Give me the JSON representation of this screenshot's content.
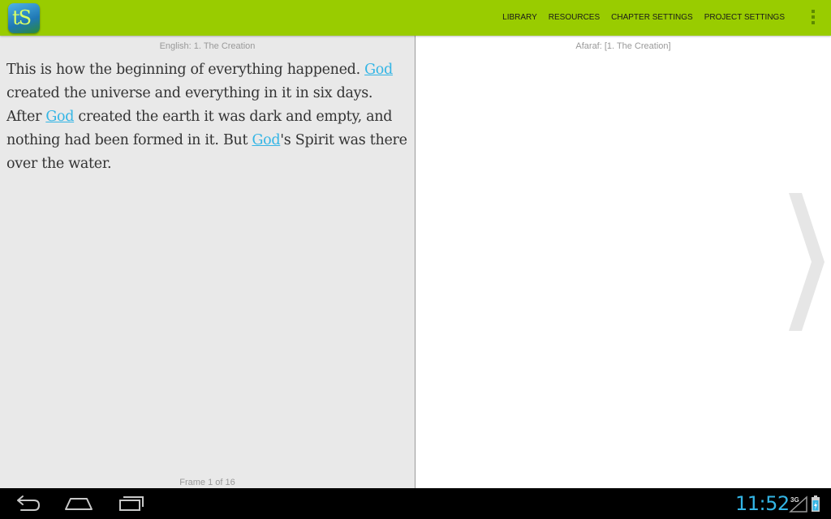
{
  "app": {
    "logo_text": "tS"
  },
  "actionbar": {
    "menu": [
      {
        "label": "LIBRARY"
      },
      {
        "label": "RESOURCES"
      },
      {
        "label": "CHAPTER SETTINGS"
      },
      {
        "label": "PROJECT SETTINGS"
      }
    ],
    "overflow_icon": "overflow-menu-icon"
  },
  "source_pane": {
    "title": "English: 1. The Creation",
    "text": {
      "p1": "This is how the beginning of everything happened. ",
      "link1": "God",
      "p2": " created the universe and everything in it in six days. After ",
      "link2": "God",
      "p3": " created the earth it was dark and empty, and nothing had been formed in it. But ",
      "link3": "God",
      "p4": "'s Spirit was there over the water."
    },
    "frame_counter": "Frame 1 of 16"
  },
  "target_pane": {
    "title": "Afaraf: [1. The Creation]",
    "next_icon": "chevron-right-icon"
  },
  "system_bar": {
    "back_icon": "back-icon",
    "home_icon": "home-icon",
    "recents_icon": "recents-icon",
    "clock": "11:52",
    "network": "3G"
  },
  "colors": {
    "accent": "#99cc00",
    "link": "#33b5e5",
    "clock": "#33b5e5"
  }
}
